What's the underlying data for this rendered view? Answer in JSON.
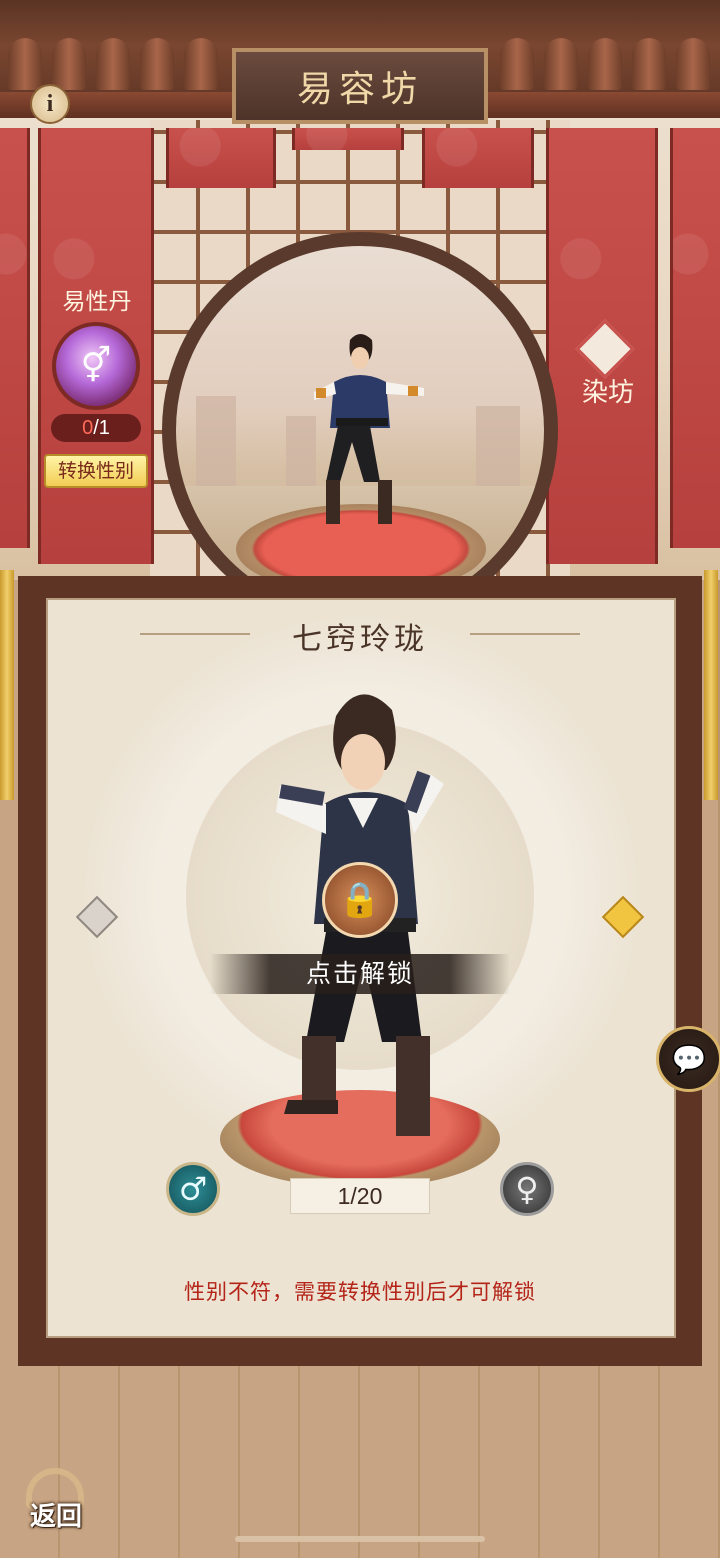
{
  "header": {
    "title": "易容坊"
  },
  "info_button": {
    "label": "i"
  },
  "gender_pill": {
    "label": "易性丹",
    "have": "0",
    "separator": "/",
    "need": "1",
    "switch_button": "转换性别"
  },
  "dye_shop": {
    "label": "染坊"
  },
  "outfit": {
    "name": "七窍玲珑",
    "unlock_text": "点击解锁",
    "progress": "1/20"
  },
  "gender_buttons": {
    "male_symbol": "♂",
    "female_symbol": "♀"
  },
  "warning": "性别不符，需要转换性别后才可解锁",
  "back_button": {
    "label": "返回"
  },
  "colors": {
    "banner_red": "#c9514d",
    "warning_red": "#b42418",
    "gold": "#f1c540",
    "male_teal": "#2d8e96"
  }
}
